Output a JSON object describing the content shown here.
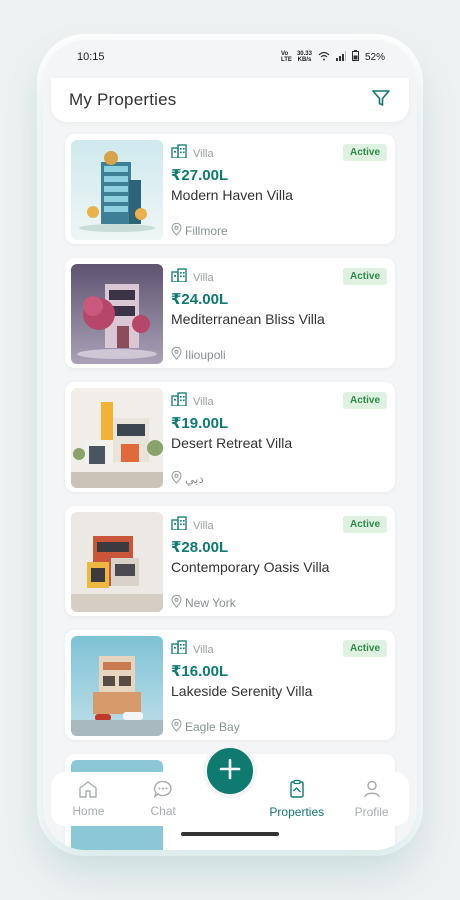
{
  "status": {
    "time": "10:15",
    "net_top": "30.33",
    "net_bottom": "KB/s",
    "battery": "52%",
    "lte_label": "Vo LTE"
  },
  "header": {
    "title": "My Properties"
  },
  "properties": [
    {
      "type": "Villa",
      "status": "Active",
      "price": "₹27.00L",
      "title": "Modern Haven Villa",
      "location": "Fillmore"
    },
    {
      "type": "Villa",
      "status": "Active",
      "price": "₹24.00L",
      "title": "Mediterranean Bliss Villa",
      "location": "Ilioupoli"
    },
    {
      "type": "Villa",
      "status": "Active",
      "price": "₹19.00L",
      "title": "Desert Retreat Villa",
      "location": "دبي"
    },
    {
      "type": "Villa",
      "status": "Active",
      "price": "₹28.00L",
      "title": "Contemporary Oasis Villa",
      "location": "New York"
    },
    {
      "type": "Villa",
      "status": "Active",
      "price": "₹16.00L",
      "title": "Lakeside Serenity Villa",
      "location": "Eagle Bay"
    }
  ],
  "nav": {
    "home": "Home",
    "chat": "Chat",
    "properties": "Properties",
    "profile": "Profile"
  },
  "colors": {
    "accent": "#0e7a70",
    "badge_bg": "#dff2e1",
    "badge_text": "#2f8a47"
  }
}
